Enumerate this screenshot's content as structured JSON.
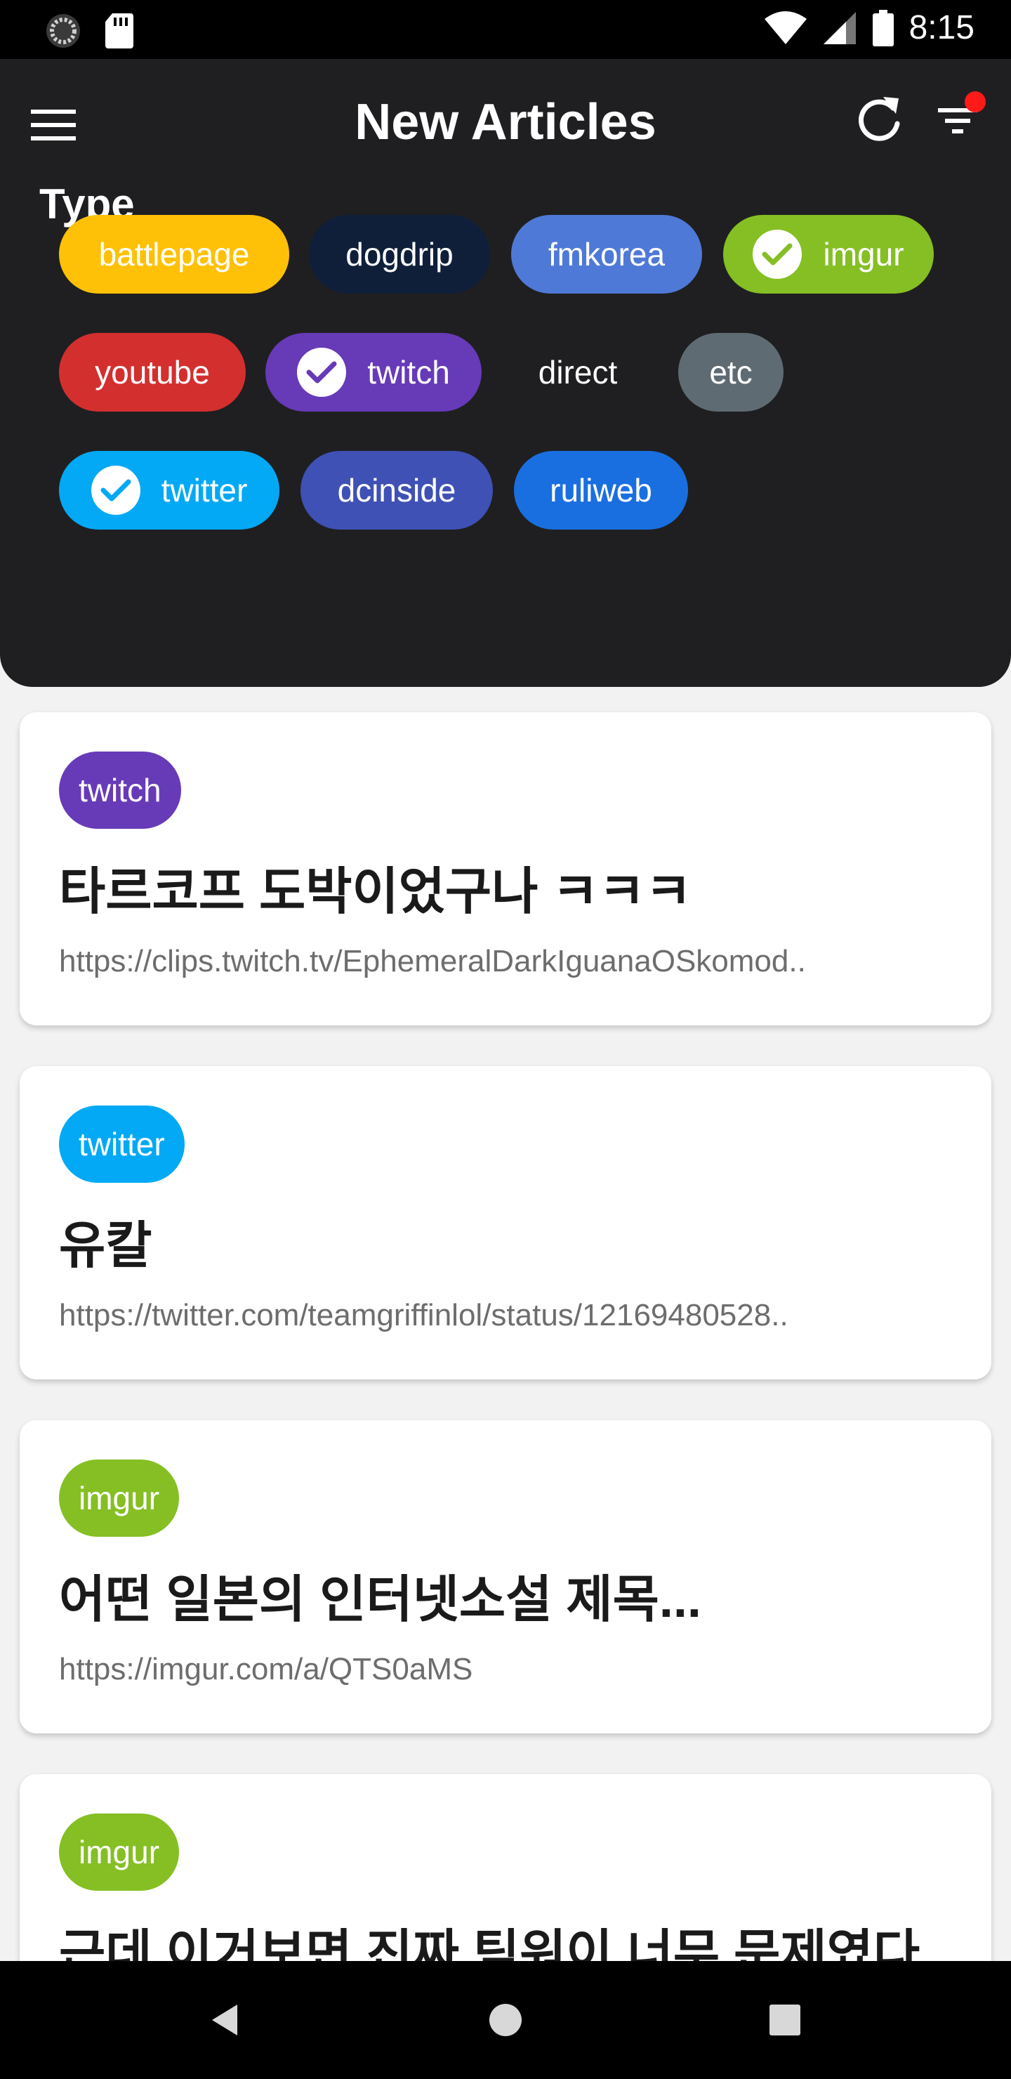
{
  "status_bar": {
    "time": "8:15"
  },
  "header": {
    "title": "New Articles",
    "section_label": "Type"
  },
  "type_chips": [
    {
      "label": "battlepage",
      "color": "#ffc107",
      "checked": false
    },
    {
      "label": "dogdrip",
      "color": "#0f1f3a",
      "checked": false
    },
    {
      "label": "fmkorea",
      "color": "#4f79d6",
      "checked": false
    },
    {
      "label": "imgur",
      "color": "#85bf24",
      "checked": true
    },
    {
      "label": "youtube",
      "color": "#d42f2f",
      "checked": false
    },
    {
      "label": "twitch",
      "color": "#673ab7",
      "checked": true
    },
    {
      "label": "direct",
      "color": "#1f1f21",
      "checked": false
    },
    {
      "label": "etc",
      "color": "#5f6b73",
      "checked": false
    },
    {
      "label": "twitter",
      "color": "#03a9f4",
      "checked": true
    },
    {
      "label": "dcinside",
      "color": "#3f51b5",
      "checked": false
    },
    {
      "label": "ruliweb",
      "color": "#1a6fe0",
      "checked": false
    }
  ],
  "articles": [
    {
      "tag": "twitch",
      "tag_color": "#673ab7",
      "title": "타르코프 도박이었구나 ㅋㅋㅋ",
      "url": "https://clips.twitch.tv/EphemeralDarkIguanaOSkomod.."
    },
    {
      "tag": "twitter",
      "tag_color": "#03a9f4",
      "title": "유칼",
      "url": "https://twitter.com/teamgriffinlol/status/12169480528.."
    },
    {
      "tag": "imgur",
      "tag_color": "#85bf24",
      "title": "어떤 일본의 인터넷소설 제목...",
      "url": "https://imgur.com/a/QTS0aMS"
    },
    {
      "tag": "imgur",
      "tag_color": "#85bf24",
      "title": "근데 이거보면 진짜 팀워이 너무 문제였다",
      "url": ""
    }
  ],
  "icons": {
    "menu": "hamburger-icon",
    "refresh": "refresh-icon",
    "filter": "filter-icon",
    "check": "check-icon",
    "back": "back-icon",
    "home": "home-icon",
    "recents": "recents-icon"
  },
  "colors": {
    "header_bg": "#1f1f21",
    "notification_dot": "#ff1a1a"
  }
}
